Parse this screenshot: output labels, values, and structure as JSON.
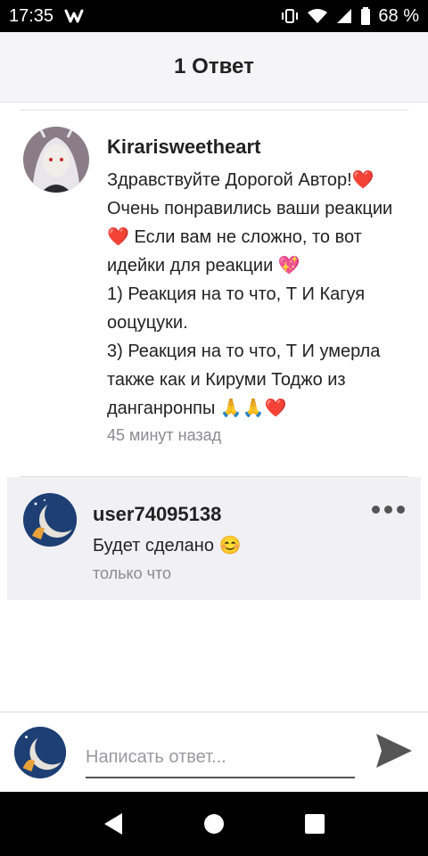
{
  "status_bar": {
    "time": "17:35",
    "app_icon": "wattpad-w-icon",
    "battery": "68 %",
    "icons": [
      "vibrate-icon",
      "wifi-icon",
      "signal-icon",
      "battery-icon"
    ]
  },
  "header": {
    "title": "1 Ответ"
  },
  "comment": {
    "author": "Kirarisweetheart",
    "text": "Здравствуйте Дорогой Автор!❤️\nОчень понравились ваши реакции\n❤️ Если вам не сложно, то вот\nидейки для реакции 💖\n1) Реакция на то что, Т И Кагуя\nооцуцуки.\n3) Реакция на то что, Т И умерла\nтакже как и Кируми Тоджо из\nданганронпы 🙏🙏❤️",
    "time": "45 минут назад"
  },
  "reply": {
    "author": "user74095138",
    "text": "Будет сделано 😊",
    "time": "только что"
  },
  "composer": {
    "placeholder": "Написать ответ..."
  },
  "colors": {
    "header_bg": "#f5f5f7",
    "reply_bg": "#f1f0f5",
    "heart": "#e02020"
  }
}
